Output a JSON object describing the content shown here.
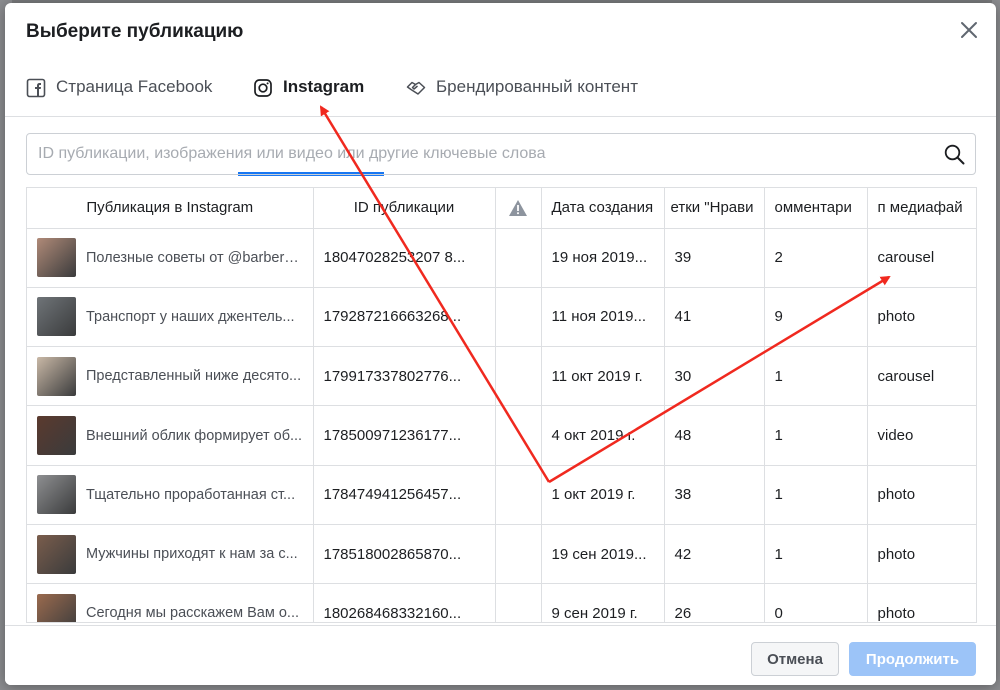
{
  "modal": {
    "title": "Выберите публикацию"
  },
  "tabs": [
    {
      "label": "Страница Facebook",
      "icon": "facebook-icon"
    },
    {
      "label": "Instagram",
      "icon": "instagram-icon",
      "active": true
    },
    {
      "label": "Брендированный контент",
      "icon": "handshake-icon"
    }
  ],
  "search": {
    "placeholder": "ID публикации, изображения или видео или другие ключевые слова"
  },
  "table": {
    "columns": [
      "Публикация в Instagram",
      "ID публикации",
      "",
      "Дата создания",
      "етки \"Нрави",
      "омментари",
      "п медиафай"
    ],
    "rows": [
      {
        "text": "Полезные советы от @barber_...",
        "id": "18047028253207 8...",
        "date": "19 ноя 2019...",
        "likes": "39",
        "comments": "2",
        "type": "carousel",
        "thumb": "#b08a78"
      },
      {
        "text": "Транспорт у наших джентель...",
        "id": "179287216663268...",
        "date": "11 ноя 2019...",
        "likes": "41",
        "comments": "9",
        "type": "photo",
        "thumb": "#6f7478"
      },
      {
        "text": "Представленный ниже десято...",
        "id": "179917337802776...",
        "date": "11 окт 2019 г.",
        "likes": "30",
        "comments": "1",
        "type": "carousel",
        "thumb": "#c9b8a6"
      },
      {
        "text": "Внешний облик формирует об...",
        "id": "178500971236177...",
        "date": "4 окт 2019 г.",
        "likes": "48",
        "comments": "1",
        "type": "video",
        "thumb": "#5b3a2e"
      },
      {
        "text": "Тщательно проработанная ст...",
        "id": "178474941256457...",
        "date": "1 окт 2019 г.",
        "likes": "38",
        "comments": "1",
        "type": "photo",
        "thumb": "#8e8f91"
      },
      {
        "text": "Мужчины приходят к нам за с...",
        "id": "178518002865870...",
        "date": "19 сен 2019...",
        "likes": "42",
        "comments": "1",
        "type": "photo",
        "thumb": "#7a5d4c"
      },
      {
        "text": "Сегодня мы расскажем Вам о...",
        "id": "180268468332160...",
        "date": "9 сен 2019 г.",
        "likes": "26",
        "comments": "0",
        "type": "photo",
        "thumb": "#9a6a4e"
      }
    ]
  },
  "footer": {
    "cancel_label": "Отмена",
    "continue_label": "Продолжить"
  },
  "colors": {
    "accent": "#1877f2",
    "annotation_arrow": "#f0291f",
    "continue_disabled": "#9cc4f8"
  }
}
